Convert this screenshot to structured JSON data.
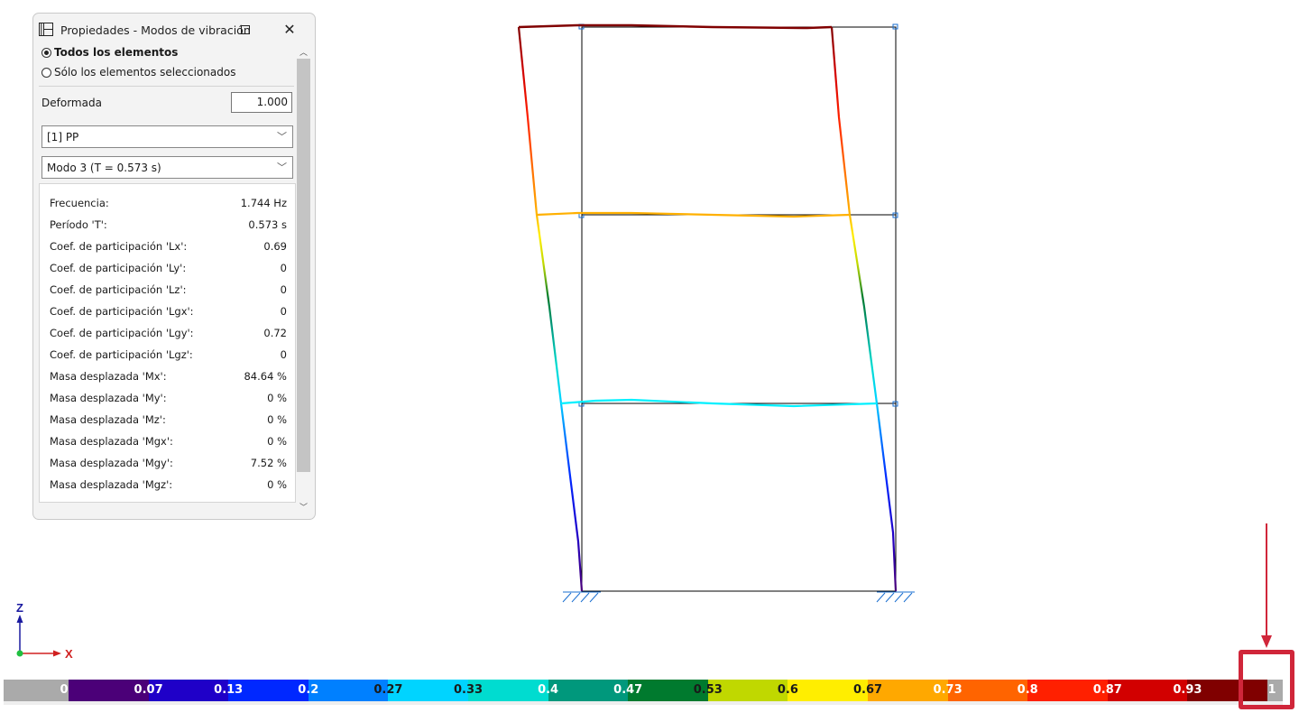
{
  "panel": {
    "title": "Propiedades - Modos de vibración",
    "radio_all": "Todos los elementos",
    "radio_selected": "Sólo los elementos seleccionados",
    "deformada_label": "Deformada",
    "deformada_value": "1.000",
    "load_case": "[1] PP",
    "mode": "Modo 3 (T = 0.573 s)",
    "properties": [
      {
        "k": "Frecuencia:",
        "v": "1.744  Hz"
      },
      {
        "k": "Período 'T':",
        "v": "0.573 s"
      },
      {
        "k": "Coef. de participación 'Lx':",
        "v": "0.69"
      },
      {
        "k": "Coef. de participación 'Ly':",
        "v": "0"
      },
      {
        "k": "Coef. de participación 'Lz':",
        "v": "0"
      },
      {
        "k": "Coef. de participación 'Lgx':",
        "v": "0"
      },
      {
        "k": "Coef. de participación 'Lgy':",
        "v": "0.72"
      },
      {
        "k": "Coef. de participación 'Lgz':",
        "v": "0"
      },
      {
        "k": "Masa desplazada 'Mx':",
        "v": "84.64 %"
      },
      {
        "k": "Masa desplazada 'My':",
        "v": "0 %"
      },
      {
        "k": "Masa desplazada 'Mz':",
        "v": "0 %"
      },
      {
        "k": "Masa desplazada 'Mgx':",
        "v": "0 %"
      },
      {
        "k": "Masa desplazada 'Mgy':",
        "v": "7.52 %"
      },
      {
        "k": "Masa desplazada 'Mgz':",
        "v": "0 %"
      }
    ]
  },
  "axes": {
    "z": "Z",
    "x": "X"
  },
  "legend": {
    "labels": [
      "0",
      "0.07",
      "0.13",
      "0.2",
      "0.27",
      "0.33",
      "0.4",
      "0.47",
      "0.53",
      "0.6",
      "0.67",
      "0.73",
      "0.8",
      "0.87",
      "0.93",
      "1"
    ],
    "label_colors": [
      "#ffffff",
      "#ffffff",
      "#ffffff",
      "#ffffff",
      "#1a1a1a",
      "#1a1a1a",
      "#ffffff",
      "#ffffff",
      "#1a1a1a",
      "#1a1a1a",
      "#1a1a1a",
      "#ffffff",
      "#ffffff",
      "#ffffff",
      "#ffffff",
      "#ffffff"
    ],
    "colors": [
      "#4b0078",
      "#1f00c8",
      "#0028ff",
      "#0080ff",
      "#00d4ff",
      "#00dcd0",
      "#00987c",
      "#007a2e",
      "#c0d800",
      "#ffee00",
      "#ffa800",
      "#ff6400",
      "#ff2000",
      "#d20000",
      "#800000"
    ],
    "out_of_range_color": "#aaaaaa",
    "highlight_color": "#d0263a"
  }
}
